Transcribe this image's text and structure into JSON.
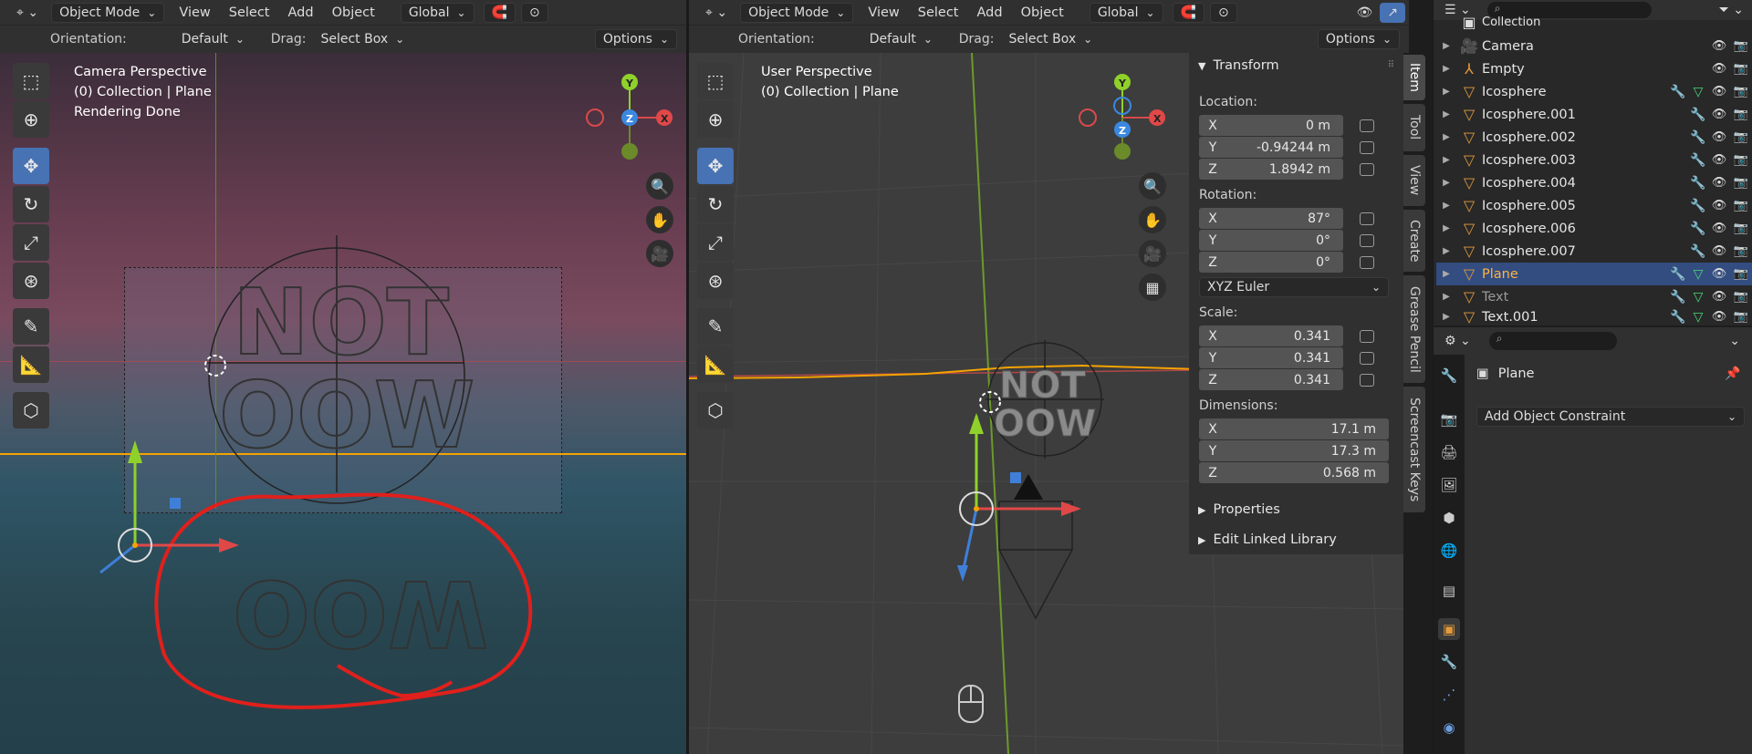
{
  "left_viewport": {
    "header": {
      "mode": "Object Mode",
      "menus": [
        "View",
        "Select",
        "Add",
        "Object"
      ],
      "transform_orientation": "Global"
    },
    "tool_header": {
      "orientation_label": "Orientation:",
      "orientation_value": "Default",
      "drag_label": "Drag:",
      "drag_value": "Select Box",
      "options": "Options"
    },
    "overlay": {
      "line1": "Camera Perspective",
      "line2": "(0) Collection | Plane",
      "line3": "Rendering Done"
    },
    "gizmo": {
      "y": "Y",
      "z": "Z",
      "x": "X"
    }
  },
  "right_viewport": {
    "header": {
      "mode": "Object Mode",
      "menus": [
        "View",
        "Select",
        "Add",
        "Object"
      ],
      "transform_orientation": "Global"
    },
    "tool_header": {
      "orientation_label": "Orientation:",
      "orientation_value": "Default",
      "drag_label": "Drag:",
      "drag_value": "Select Box",
      "options": "Options"
    },
    "overlay": {
      "line1": "User Perspective",
      "line2": "(0) Collection | Plane"
    },
    "gizmo": {
      "y": "Y",
      "z": "Z",
      "x": "X"
    }
  },
  "n_panel": {
    "transform_title": "Transform",
    "location_label": "Location:",
    "location": [
      {
        "axis": "X",
        "value": "0 m"
      },
      {
        "axis": "Y",
        "value": "-0.94244 m"
      },
      {
        "axis": "Z",
        "value": "1.8942 m"
      }
    ],
    "rotation_label": "Rotation:",
    "rotation": [
      {
        "axis": "X",
        "value": "87°"
      },
      {
        "axis": "Y",
        "value": "0°"
      },
      {
        "axis": "Z",
        "value": "0°"
      }
    ],
    "rotation_mode": "XYZ Euler",
    "scale_label": "Scale:",
    "scale": [
      {
        "axis": "X",
        "value": "0.341"
      },
      {
        "axis": "Y",
        "value": "0.341"
      },
      {
        "axis": "Z",
        "value": "0.341"
      }
    ],
    "dimensions_label": "Dimensions:",
    "dimensions": [
      {
        "axis": "X",
        "value": "17.1 m"
      },
      {
        "axis": "Y",
        "value": "17.3 m"
      },
      {
        "axis": "Z",
        "value": "0.568 m"
      }
    ],
    "properties": "Properties",
    "edit_linked_library": "Edit Linked Library",
    "tabs": [
      "Item",
      "Tool",
      "View",
      "Create",
      "Grease Pencil",
      "Screencast Keys"
    ]
  },
  "outliner": {
    "collection": "Collection",
    "items": [
      {
        "name": "Camera",
        "icon": "camera-icon"
      },
      {
        "name": "Empty",
        "icon": "empty-icon"
      },
      {
        "name": "Icosphere",
        "icon": "mesh-icon"
      },
      {
        "name": "Icosphere.001",
        "icon": "mesh-icon"
      },
      {
        "name": "Icosphere.002",
        "icon": "mesh-icon"
      },
      {
        "name": "Icosphere.003",
        "icon": "mesh-icon"
      },
      {
        "name": "Icosphere.004",
        "icon": "mesh-icon"
      },
      {
        "name": "Icosphere.005",
        "icon": "mesh-icon"
      },
      {
        "name": "Icosphere.006",
        "icon": "mesh-icon"
      },
      {
        "name": "Icosphere.007",
        "icon": "mesh-icon"
      },
      {
        "name": "Plane",
        "icon": "mesh-icon"
      },
      {
        "name": "Text",
        "icon": "mesh-icon"
      },
      {
        "name": "Text.001",
        "icon": "mesh-icon"
      }
    ]
  },
  "properties": {
    "object_name": "Plane",
    "add_constraint": "Add Object Constraint"
  },
  "colors": {
    "accent": "#4772b3",
    "selected_name": "#ffb340",
    "annotation": "#e0201c",
    "horizon": "#f5a300"
  }
}
